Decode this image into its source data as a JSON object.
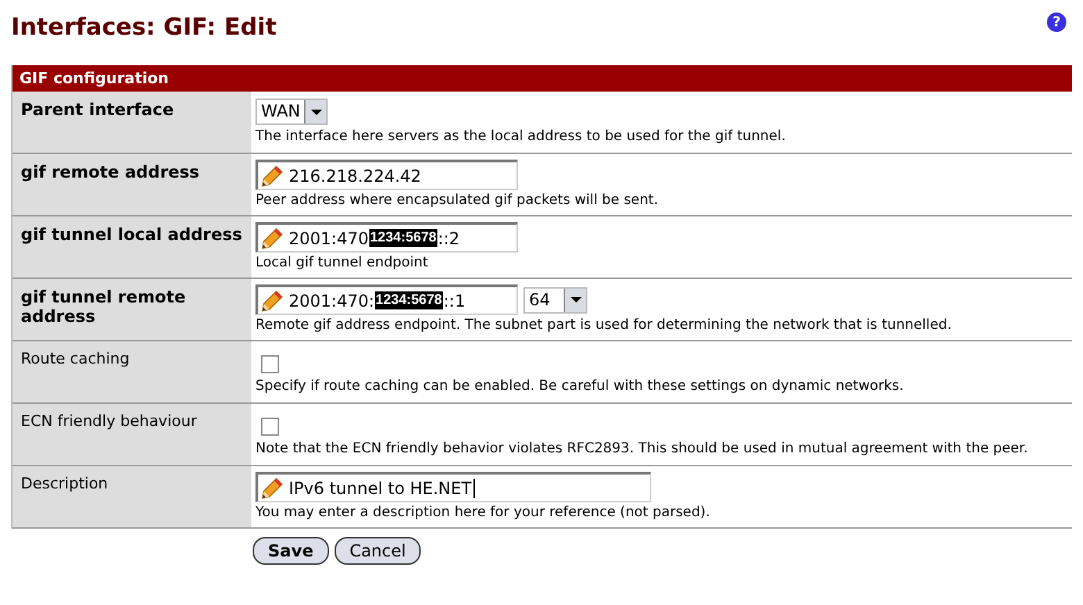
{
  "page_title": "Interfaces: GIF: Edit",
  "help": "?",
  "section_title": "GIF configuration",
  "rows": [
    {
      "label": "Parent interface",
      "required": true,
      "kind": "select",
      "select": "WAN",
      "hint": "The interface here servers as the local address to be used for the gif tunnel."
    },
    {
      "label": "gif remote address",
      "required": true,
      "kind": "text",
      "value_parts": [
        {
          "kind": "plain",
          "text": "216.218.224.42"
        }
      ],
      "hint": "Peer address where encapsulated gif packets will be sent."
    },
    {
      "label": "gif tunnel local address",
      "required": true,
      "kind": "text",
      "value_parts": [
        {
          "kind": "plain",
          "text": "2001:470"
        },
        {
          "kind": "masked",
          "text": "1234:5678"
        },
        {
          "kind": "plain",
          "text": "::2"
        }
      ],
      "hint": "Local gif tunnel endpoint"
    },
    {
      "label": "gif tunnel remote address",
      "required": true,
      "kind": "text_select",
      "value_parts": [
        {
          "kind": "plain",
          "text": "2001:470:"
        },
        {
          "kind": "masked",
          "text": "1234:5678"
        },
        {
          "kind": "plain",
          "text": "::1"
        }
      ],
      "select": "64",
      "hint": "Remote gif address endpoint. The subnet part is used for determining the network that is tunnelled."
    },
    {
      "label": "Route caching",
      "required": false,
      "kind": "checkbox",
      "checked": false,
      "hint": "Specify if route caching can be enabled. Be careful with these settings on dynamic networks."
    },
    {
      "label": "ECN friendly behaviour",
      "required": false,
      "kind": "checkbox",
      "checked": false,
      "hint": "Note that the ECN friendly behavior violates RFC2893. This should be used in mutual agreement with the peer."
    },
    {
      "label": "Description",
      "required": false,
      "kind": "wide_text",
      "value_parts": [
        {
          "kind": "plain",
          "text": "IPv6 tunnel to HE.NET"
        }
      ],
      "hint": "You may enter a description here for your reference (not parsed)."
    }
  ],
  "buttons": [
    {
      "label": "Save",
      "kind": "primary"
    },
    {
      "label": "Cancel",
      "kind": "secondary"
    }
  ]
}
